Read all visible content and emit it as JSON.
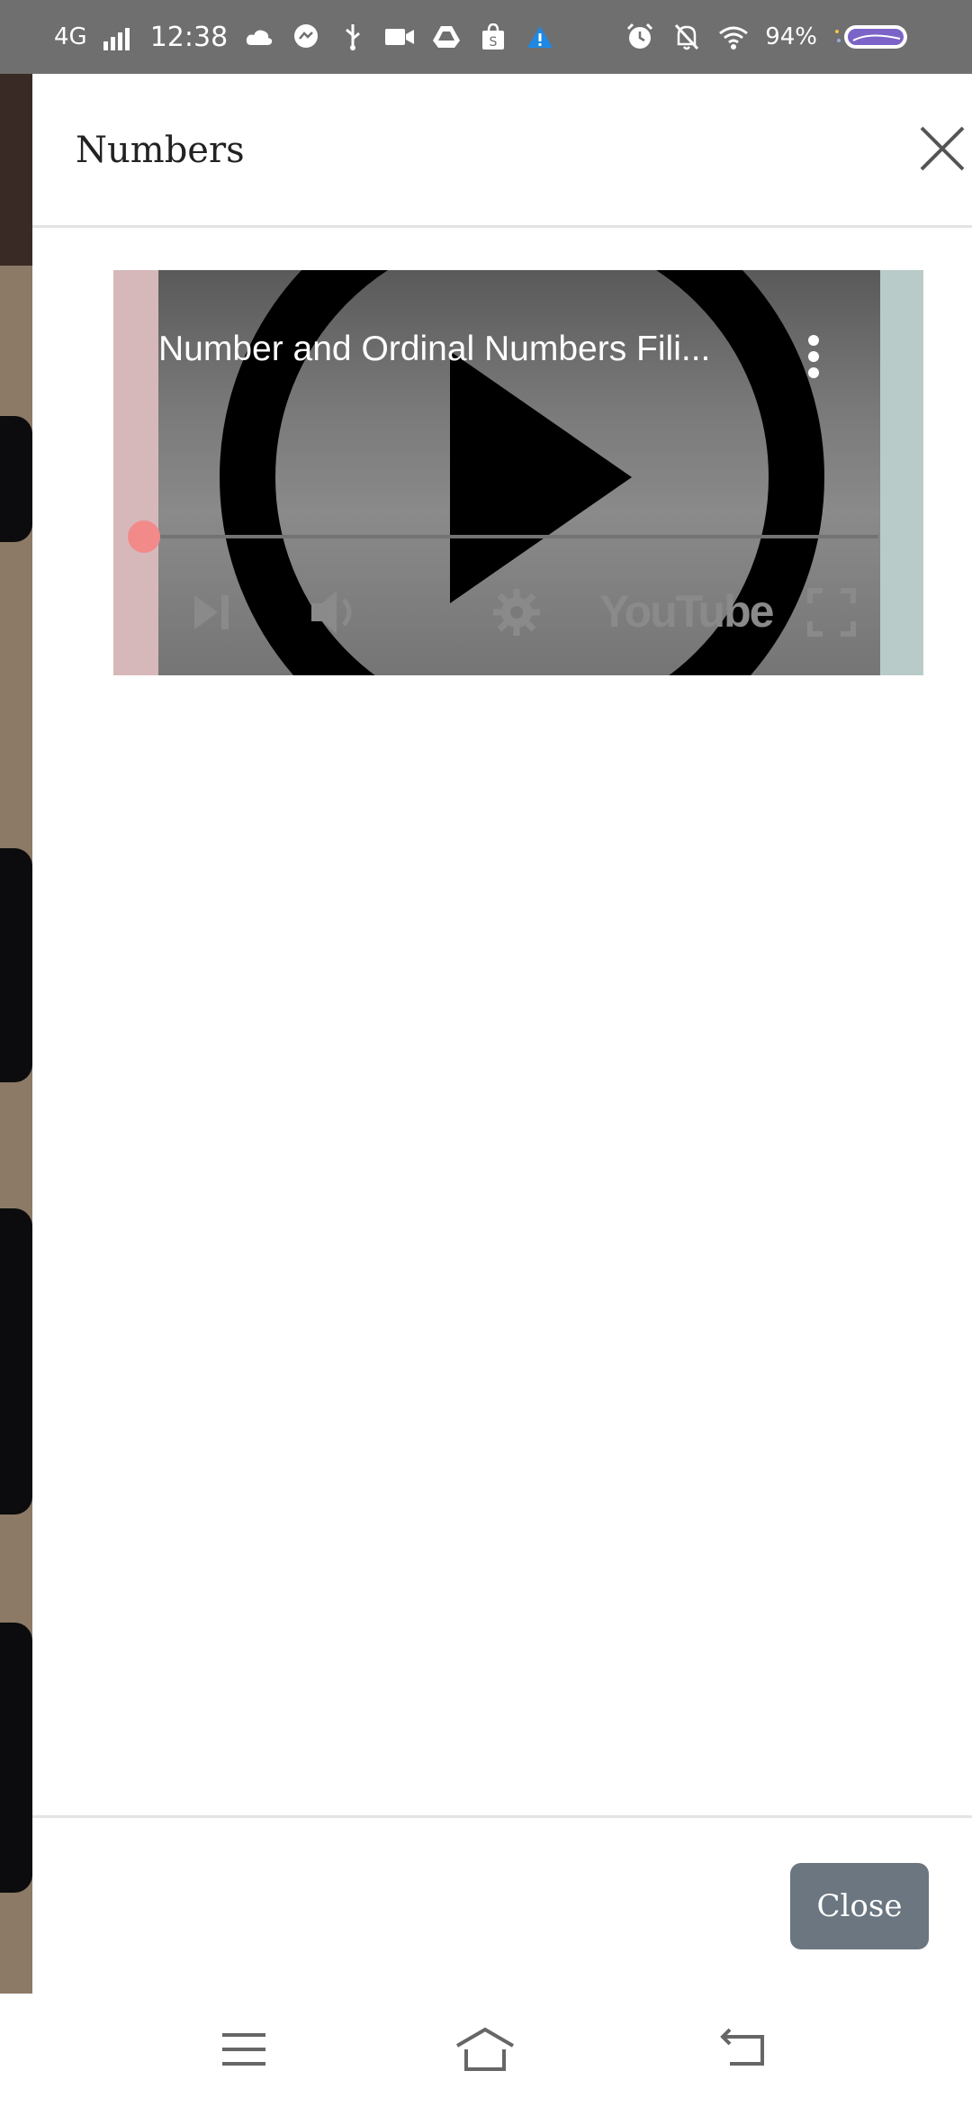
{
  "status_bar": {
    "network": "4G",
    "time": "12:38",
    "battery_percent": "94%"
  },
  "modal": {
    "title": "Numbers",
    "video": {
      "title": "Number and Ordinal Numbers Fili...",
      "brand": "YouTube"
    },
    "close_button_label": "Close"
  },
  "icons": {
    "status_left": [
      "cloud-icon",
      "messenger-icon",
      "usb-icon",
      "video-call-icon",
      "drive-icon",
      "shop-icon",
      "warning-icon"
    ],
    "status_right": [
      "alarm-icon",
      "mute-icon",
      "wifi-icon",
      "battery-icon"
    ],
    "nav": [
      "menu-icon",
      "home-icon",
      "back-icon"
    ]
  }
}
